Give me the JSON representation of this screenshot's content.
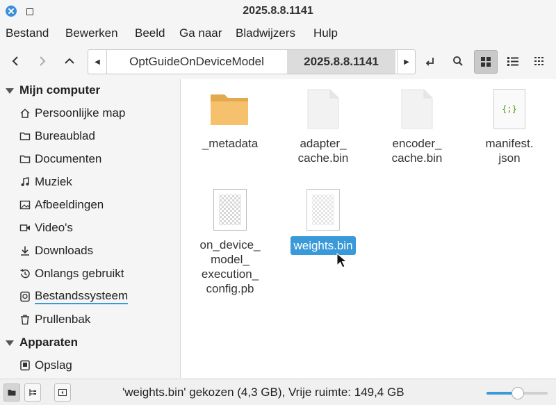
{
  "window": {
    "title": "2025.8.8.1141"
  },
  "menu": [
    "Bestand",
    "Bewerken",
    "Beeld",
    "Ga naar",
    "Bladwijzers",
    "Hulp"
  ],
  "breadcrumb": {
    "parent": "OptGuideOnDeviceModel",
    "current": "2025.8.8.1141"
  },
  "sidebar": {
    "computer_header": "Mijn computer",
    "items": [
      "Persoonlijke map",
      "Bureaublad",
      "Documenten",
      "Muziek",
      "Afbeeldingen",
      "Video's",
      "Downloads",
      "Onlangs gebruikt",
      "Bestandssysteem",
      "Prullenbak"
    ],
    "devices_header": "Apparaten",
    "devices": [
      "Opslag"
    ]
  },
  "files": [
    {
      "name_lines": [
        "_metadata"
      ],
      "type": "folder"
    },
    {
      "name_lines": [
        "adapter_",
        "cache.bin"
      ],
      "type": "blank"
    },
    {
      "name_lines": [
        "encoder_",
        "cache.bin"
      ],
      "type": "blank"
    },
    {
      "name_lines": [
        "manifest.",
        "json"
      ],
      "type": "json"
    },
    {
      "name_lines": [
        "on_device_",
        "model_",
        "execution_",
        "config.pb"
      ],
      "type": "binary"
    },
    {
      "name_lines": [
        "weights.bin"
      ],
      "type": "binary",
      "selected": true
    }
  ],
  "json_icon_glyph": "{;}",
  "status": {
    "text": "'weights.bin' gekozen (4,3 GB), Vrije ruimte: 149,4 GB"
  },
  "zoom": {
    "level": 0.5
  },
  "colors": {
    "accent": "#3a99d8",
    "folder": "#f5c16c",
    "json_green": "#4e9a06"
  }
}
